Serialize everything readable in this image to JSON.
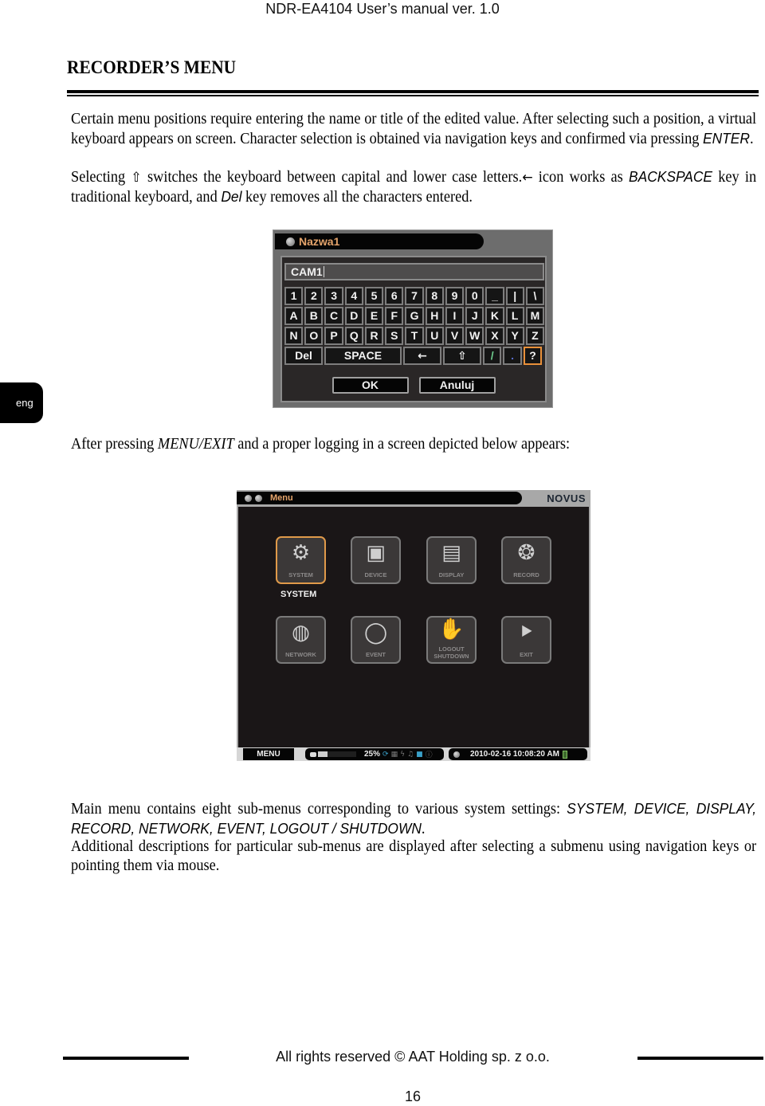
{
  "header": {
    "running_title": "NDR-EA4104 User’s manual ver. 1.0"
  },
  "section": {
    "title": "RECORDER’S MENU"
  },
  "intro": {
    "p1_text": "Certain menu positions require entering the name or title of the edited value. After selecting such a position, a virtual keyboard appears on screen. Character selection is obtained via navigation keys and confirmed via pressing ",
    "p1_enter": "ENTER",
    "p1_end": ".",
    "p2_a": "Selecting ",
    "p2_shift_icon": "⇧",
    "p2_b": " switches the keyboard between capital and lower case letters.",
    "p2_back_icon": "←",
    "p2_c": " icon works as ",
    "p2_backspace": "BACKSPACE",
    "p2_d": " key in traditional keyboard, and ",
    "p2_del": "Del",
    "p2_e": " key removes all the characters entered."
  },
  "keyboard_dialog": {
    "title": "Nazwa1",
    "input_value": "CAM1",
    "rows": [
      [
        "1",
        "2",
        "3",
        "4",
        "5",
        "6",
        "7",
        "8",
        "9",
        "0",
        "_",
        "|",
        "\\"
      ],
      [
        "A",
        "B",
        "C",
        "D",
        "E",
        "F",
        "G",
        "H",
        "I",
        "J",
        "K",
        "L",
        "M"
      ],
      [
        "N",
        "O",
        "P",
        "Q",
        "R",
        "S",
        "T",
        "U",
        "V",
        "W",
        "X",
        "Y",
        "Z"
      ]
    ],
    "bottom_row": {
      "del": "Del",
      "space": "SPACE",
      "backspace": "←",
      "shift": "⇧",
      "slash": "/",
      "dot": ".",
      "question": "?"
    },
    "selected_key": "?",
    "ok_label": "OK",
    "cancel_label": "Anuluj"
  },
  "side_tab": {
    "label": "eng"
  },
  "mid_para": {
    "a": "After pressing ",
    "menu_exit": "MENU/EXIT",
    "b": " and a proper logging in  a screen depicted below appears:"
  },
  "main_menu": {
    "title": "Menu",
    "brand": "NOVUS",
    "tiles": [
      {
        "label": "SYSTEM",
        "icon": "⚙",
        "icon_name": "gear-icon"
      },
      {
        "label": "DEVICE",
        "icon": "▣",
        "icon_name": "camera-icon"
      },
      {
        "label": "DISPLAY",
        "icon": "▤",
        "icon_name": "monitor-icon"
      },
      {
        "label": "RECORD",
        "icon": "❂",
        "icon_name": "film-reel-icon"
      },
      {
        "label": "NETWORK",
        "icon": "◍",
        "icon_name": "globe-icon"
      },
      {
        "label": "EVENT",
        "icon": "◯",
        "icon_name": "lightbulb-icon"
      },
      {
        "label": "LOGOUT\nSHUTDOWN",
        "label_line1": "LOGOUT",
        "label_line2": "SHUTDOWN",
        "icon": "✋",
        "icon_name": "keys-hand-icon"
      },
      {
        "label": "EXIT",
        "icon": "⯈",
        "icon_name": "exit-door-icon"
      }
    ],
    "selected_tile": "SYSTEM",
    "selected_caption": "SYSTEM",
    "status": {
      "menu_label": "MENU",
      "hdd_usage_percent": 25,
      "hdd_usage_text": "25%",
      "datetime": "2010-02-16 10:08:20 AM"
    }
  },
  "closing": {
    "p1_a": "Main menu contains eight sub-menus corresponding to various system settings: ",
    "p1_list": "SYSTEM, DEVICE, DISPLAY, RECORD, NETWORK, EVENT, LOGOUT / SHUTDOWN",
    "p1_end": ".",
    "p2": "Additional descriptions for particular sub-menus are displayed after selecting a submenu using navigation keys or pointing them via mouse."
  },
  "footer": {
    "text": "All rights reserved © AAT Holding sp. z o.o.",
    "page_number": "16"
  }
}
